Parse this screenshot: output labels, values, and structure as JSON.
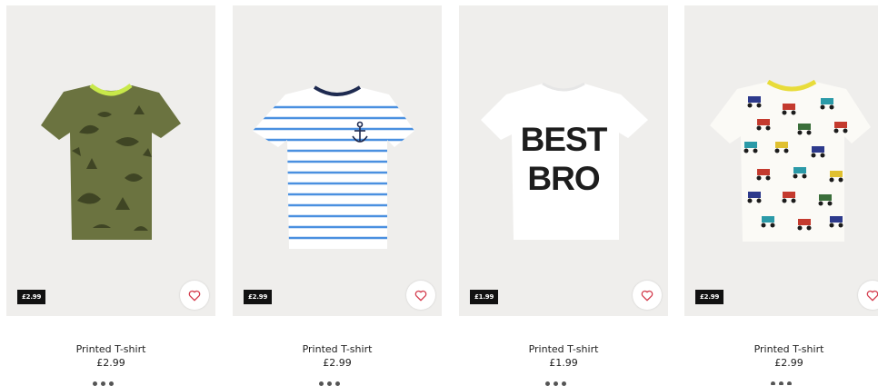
{
  "products": [
    {
      "badge": "£2.99",
      "name": "Printed T-shirt",
      "price": "£2.99",
      "shirt_color": "#6b7340"
    },
    {
      "badge": "£2.99",
      "name": "Printed T-shirt",
      "price": "£2.99",
      "shirt_color": "#ffffff"
    },
    {
      "badge": "£1.99",
      "name": "Printed T-shirt",
      "price": "£1.99",
      "shirt_color": "#ffffff",
      "print": "BEST BRO"
    },
    {
      "badge": "£2.99",
      "name": "Printed T-shirt",
      "price": "£2.99",
      "shirt_color": "#ffffff"
    }
  ],
  "icons": {
    "favourite": "heart-outline-icon"
  },
  "colors": {
    "heart": "#d43d4e",
    "badge_bg": "#111111",
    "image_bg": "#efeeec",
    "stripe": "#4a90e0"
  }
}
